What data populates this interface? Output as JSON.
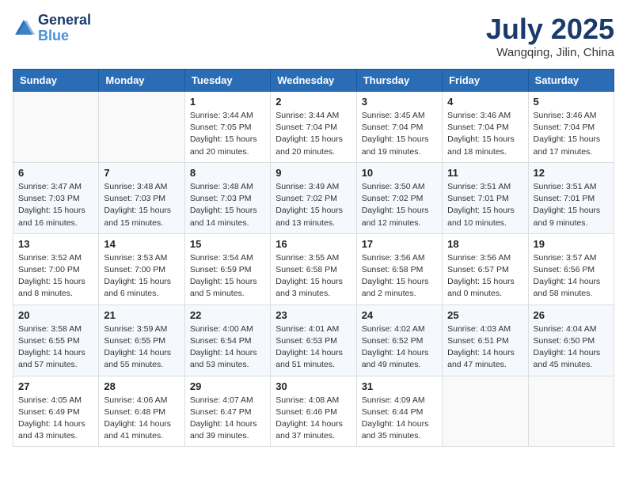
{
  "header": {
    "logo_line1": "General",
    "logo_line2": "Blue",
    "month": "July 2025",
    "location": "Wangqing, Jilin, China"
  },
  "weekdays": [
    "Sunday",
    "Monday",
    "Tuesday",
    "Wednesday",
    "Thursday",
    "Friday",
    "Saturday"
  ],
  "weeks": [
    [
      {
        "day": "",
        "sunrise": "",
        "sunset": "",
        "daylight": ""
      },
      {
        "day": "",
        "sunrise": "",
        "sunset": "",
        "daylight": ""
      },
      {
        "day": "1",
        "sunrise": "Sunrise: 3:44 AM",
        "sunset": "Sunset: 7:05 PM",
        "daylight": "Daylight: 15 hours and 20 minutes."
      },
      {
        "day": "2",
        "sunrise": "Sunrise: 3:44 AM",
        "sunset": "Sunset: 7:04 PM",
        "daylight": "Daylight: 15 hours and 20 minutes."
      },
      {
        "day": "3",
        "sunrise": "Sunrise: 3:45 AM",
        "sunset": "Sunset: 7:04 PM",
        "daylight": "Daylight: 15 hours and 19 minutes."
      },
      {
        "day": "4",
        "sunrise": "Sunrise: 3:46 AM",
        "sunset": "Sunset: 7:04 PM",
        "daylight": "Daylight: 15 hours and 18 minutes."
      },
      {
        "day": "5",
        "sunrise": "Sunrise: 3:46 AM",
        "sunset": "Sunset: 7:04 PM",
        "daylight": "Daylight: 15 hours and 17 minutes."
      }
    ],
    [
      {
        "day": "6",
        "sunrise": "Sunrise: 3:47 AM",
        "sunset": "Sunset: 7:03 PM",
        "daylight": "Daylight: 15 hours and 16 minutes."
      },
      {
        "day": "7",
        "sunrise": "Sunrise: 3:48 AM",
        "sunset": "Sunset: 7:03 PM",
        "daylight": "Daylight: 15 hours and 15 minutes."
      },
      {
        "day": "8",
        "sunrise": "Sunrise: 3:48 AM",
        "sunset": "Sunset: 7:03 PM",
        "daylight": "Daylight: 15 hours and 14 minutes."
      },
      {
        "day": "9",
        "sunrise": "Sunrise: 3:49 AM",
        "sunset": "Sunset: 7:02 PM",
        "daylight": "Daylight: 15 hours and 13 minutes."
      },
      {
        "day": "10",
        "sunrise": "Sunrise: 3:50 AM",
        "sunset": "Sunset: 7:02 PM",
        "daylight": "Daylight: 15 hours and 12 minutes."
      },
      {
        "day": "11",
        "sunrise": "Sunrise: 3:51 AM",
        "sunset": "Sunset: 7:01 PM",
        "daylight": "Daylight: 15 hours and 10 minutes."
      },
      {
        "day": "12",
        "sunrise": "Sunrise: 3:51 AM",
        "sunset": "Sunset: 7:01 PM",
        "daylight": "Daylight: 15 hours and 9 minutes."
      }
    ],
    [
      {
        "day": "13",
        "sunrise": "Sunrise: 3:52 AM",
        "sunset": "Sunset: 7:00 PM",
        "daylight": "Daylight: 15 hours and 8 minutes."
      },
      {
        "day": "14",
        "sunrise": "Sunrise: 3:53 AM",
        "sunset": "Sunset: 7:00 PM",
        "daylight": "Daylight: 15 hours and 6 minutes."
      },
      {
        "day": "15",
        "sunrise": "Sunrise: 3:54 AM",
        "sunset": "Sunset: 6:59 PM",
        "daylight": "Daylight: 15 hours and 5 minutes."
      },
      {
        "day": "16",
        "sunrise": "Sunrise: 3:55 AM",
        "sunset": "Sunset: 6:58 PM",
        "daylight": "Daylight: 15 hours and 3 minutes."
      },
      {
        "day": "17",
        "sunrise": "Sunrise: 3:56 AM",
        "sunset": "Sunset: 6:58 PM",
        "daylight": "Daylight: 15 hours and 2 minutes."
      },
      {
        "day": "18",
        "sunrise": "Sunrise: 3:56 AM",
        "sunset": "Sunset: 6:57 PM",
        "daylight": "Daylight: 15 hours and 0 minutes."
      },
      {
        "day": "19",
        "sunrise": "Sunrise: 3:57 AM",
        "sunset": "Sunset: 6:56 PM",
        "daylight": "Daylight: 14 hours and 58 minutes."
      }
    ],
    [
      {
        "day": "20",
        "sunrise": "Sunrise: 3:58 AM",
        "sunset": "Sunset: 6:55 PM",
        "daylight": "Daylight: 14 hours and 57 minutes."
      },
      {
        "day": "21",
        "sunrise": "Sunrise: 3:59 AM",
        "sunset": "Sunset: 6:55 PM",
        "daylight": "Daylight: 14 hours and 55 minutes."
      },
      {
        "day": "22",
        "sunrise": "Sunrise: 4:00 AM",
        "sunset": "Sunset: 6:54 PM",
        "daylight": "Daylight: 14 hours and 53 minutes."
      },
      {
        "day": "23",
        "sunrise": "Sunrise: 4:01 AM",
        "sunset": "Sunset: 6:53 PM",
        "daylight": "Daylight: 14 hours and 51 minutes."
      },
      {
        "day": "24",
        "sunrise": "Sunrise: 4:02 AM",
        "sunset": "Sunset: 6:52 PM",
        "daylight": "Daylight: 14 hours and 49 minutes."
      },
      {
        "day": "25",
        "sunrise": "Sunrise: 4:03 AM",
        "sunset": "Sunset: 6:51 PM",
        "daylight": "Daylight: 14 hours and 47 minutes."
      },
      {
        "day": "26",
        "sunrise": "Sunrise: 4:04 AM",
        "sunset": "Sunset: 6:50 PM",
        "daylight": "Daylight: 14 hours and 45 minutes."
      }
    ],
    [
      {
        "day": "27",
        "sunrise": "Sunrise: 4:05 AM",
        "sunset": "Sunset: 6:49 PM",
        "daylight": "Daylight: 14 hours and 43 minutes."
      },
      {
        "day": "28",
        "sunrise": "Sunrise: 4:06 AM",
        "sunset": "Sunset: 6:48 PM",
        "daylight": "Daylight: 14 hours and 41 minutes."
      },
      {
        "day": "29",
        "sunrise": "Sunrise: 4:07 AM",
        "sunset": "Sunset: 6:47 PM",
        "daylight": "Daylight: 14 hours and 39 minutes."
      },
      {
        "day": "30",
        "sunrise": "Sunrise: 4:08 AM",
        "sunset": "Sunset: 6:46 PM",
        "daylight": "Daylight: 14 hours and 37 minutes."
      },
      {
        "day": "31",
        "sunrise": "Sunrise: 4:09 AM",
        "sunset": "Sunset: 6:44 PM",
        "daylight": "Daylight: 14 hours and 35 minutes."
      },
      {
        "day": "",
        "sunrise": "",
        "sunset": "",
        "daylight": ""
      },
      {
        "day": "",
        "sunrise": "",
        "sunset": "",
        "daylight": ""
      }
    ]
  ]
}
